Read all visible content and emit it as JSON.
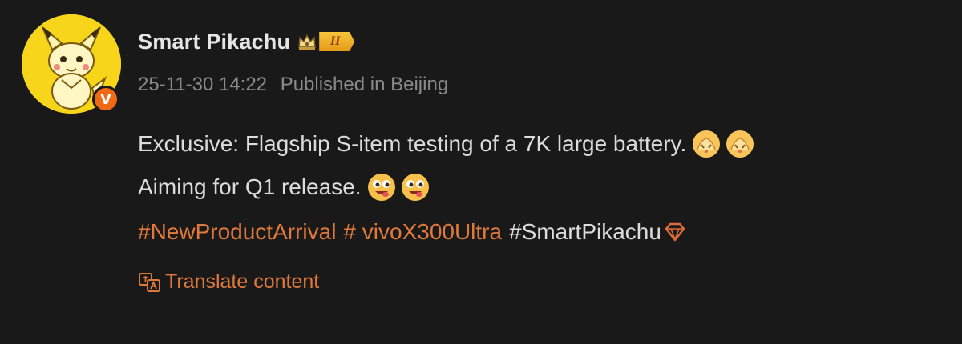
{
  "post": {
    "author": {
      "name": "Smart Pikachu",
      "verified_badge": "V",
      "level_badge": "II",
      "icons": [
        "crown-icon",
        "level-badge",
        "verified-badge"
      ]
    },
    "meta": {
      "timestamp": "25-11-30 14:22",
      "location": "Published in Beijing"
    },
    "content": {
      "line1": "Exclusive: Flagship S-item testing of a 7K large battery.",
      "line2": "Aiming for Q1 release.",
      "emoji_line1": [
        "hands-emoji",
        "hands-emoji"
      ],
      "emoji_line2": [
        "yummy-emoji",
        "yummy-emoji"
      ],
      "tags": [
        {
          "text": "#NewProductArrival",
          "style": "link"
        },
        {
          "text": "# vivoX300Ultra",
          "style": "link"
        },
        {
          "text": "#SmartPikachu",
          "style": "plain",
          "icon": "diamond-icon"
        }
      ]
    },
    "translate_label": "Translate content"
  },
  "colors": {
    "background": "#191919",
    "link": "#e07a3b",
    "text": "#dcdcdc",
    "meta": "#8a8a8a",
    "avatar_bg": "#f7d51a",
    "verified": "#f06a14"
  }
}
